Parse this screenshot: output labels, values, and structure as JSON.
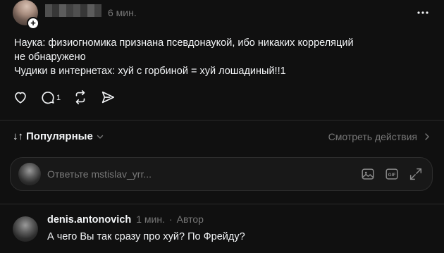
{
  "post": {
    "time": "6 мин.",
    "lines": [
      "Наука: физиогномика признана псевдонаукой, ибо никаких корреляций",
      "не обнаружено",
      "Чудики в интернетах: хуй с горбиной = хуй лошадиный!!1"
    ],
    "actions": {
      "reply_count": "1"
    }
  },
  "sort": {
    "label": "Популярные",
    "arrows_glyph": "↓↑",
    "activity_link": "Смотреть действия"
  },
  "reply": {
    "placeholder": "Ответьте mstislav_yrr..."
  },
  "comment": {
    "username": "denis.antonovich",
    "time": "1 мин.",
    "separator": "·",
    "role": "Автор",
    "text": "А чего Вы так сразу про хуй? По Фрейду?"
  },
  "colors": {
    "background": "#101010",
    "text": "#f3f5f7",
    "muted": "#777777",
    "divider": "#2a2a2a"
  }
}
